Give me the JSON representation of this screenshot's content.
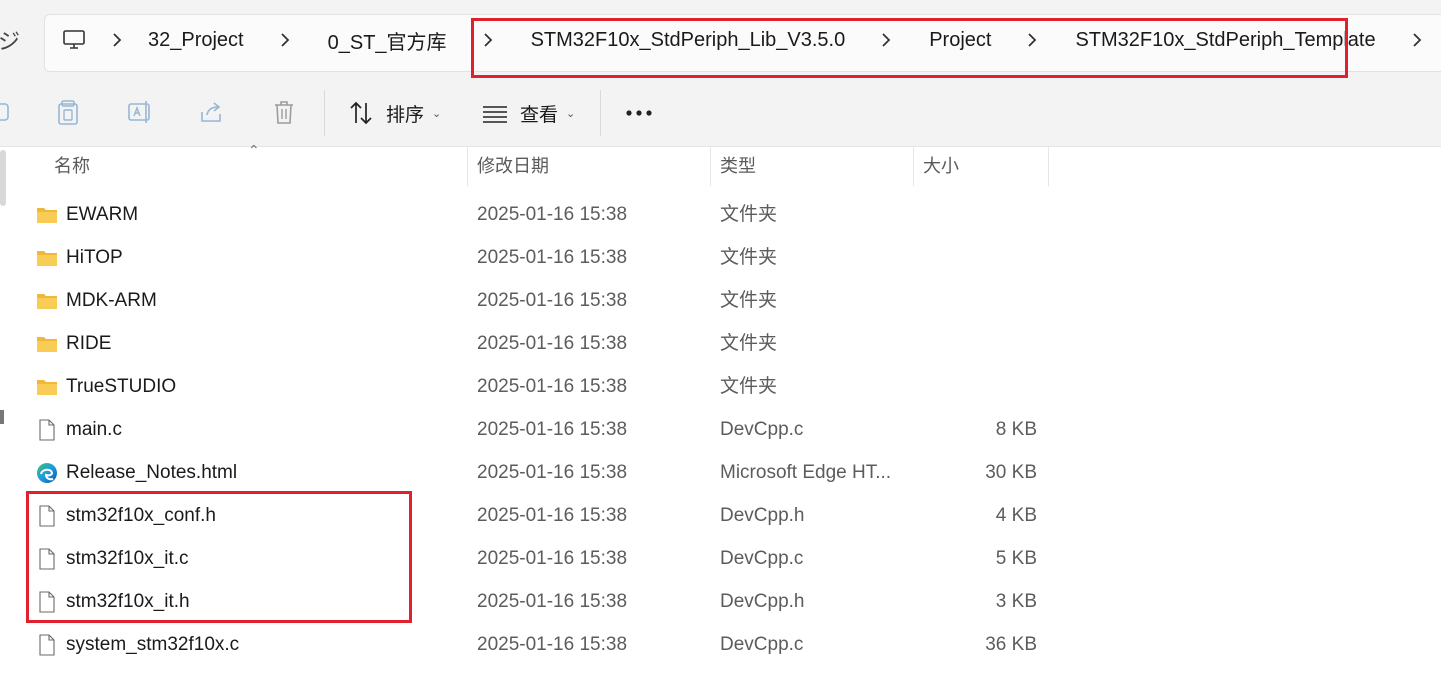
{
  "address": {
    "crumbs": [
      "32_Project",
      "0_ST_官方库",
      "STM32F10x_StdPeriph_Lib_V3.5.0",
      "Project",
      "STM32F10x_StdPeriph_Template"
    ]
  },
  "toolbar": {
    "sort_label": "排序",
    "view_label": "查看"
  },
  "columns": {
    "name": "名称",
    "date": "修改日期",
    "type": "类型",
    "size": "大小"
  },
  "files": [
    {
      "name": "EWARM",
      "date": "2025-01-16 15:38",
      "type": "文件夹",
      "size": "",
      "icon": "folder-icon"
    },
    {
      "name": "HiTOP",
      "date": "2025-01-16 15:38",
      "type": "文件夹",
      "size": "",
      "icon": "folder-icon"
    },
    {
      "name": "MDK-ARM",
      "date": "2025-01-16 15:38",
      "type": "文件夹",
      "size": "",
      "icon": "folder-icon"
    },
    {
      "name": "RIDE",
      "date": "2025-01-16 15:38",
      "type": "文件夹",
      "size": "",
      "icon": "folder-icon"
    },
    {
      "name": "TrueSTUDIO",
      "date": "2025-01-16 15:38",
      "type": "文件夹",
      "size": "",
      "icon": "folder-icon"
    },
    {
      "name": "main.c",
      "date": "2025-01-16 15:38",
      "type": "DevCpp.c",
      "size": "8 KB",
      "icon": "file-icon"
    },
    {
      "name": "Release_Notes.html",
      "date": "2025-01-16 15:38",
      "type": "Microsoft Edge HT...",
      "size": "30 KB",
      "icon": "edge-icon"
    },
    {
      "name": "stm32f10x_conf.h",
      "date": "2025-01-16 15:38",
      "type": "DevCpp.h",
      "size": "4 KB",
      "icon": "file-icon"
    },
    {
      "name": "stm32f10x_it.c",
      "date": "2025-01-16 15:38",
      "type": "DevCpp.c",
      "size": "5 KB",
      "icon": "file-icon"
    },
    {
      "name": "stm32f10x_it.h",
      "date": "2025-01-16 15:38",
      "type": "DevCpp.h",
      "size": "3 KB",
      "icon": "file-icon"
    },
    {
      "name": "system_stm32f10x.c",
      "date": "2025-01-16 15:38",
      "type": "DevCpp.c",
      "size": "36 KB",
      "icon": "file-icon"
    }
  ],
  "colors": {
    "highlight": "#e0202c",
    "folder": "#f7c544"
  }
}
